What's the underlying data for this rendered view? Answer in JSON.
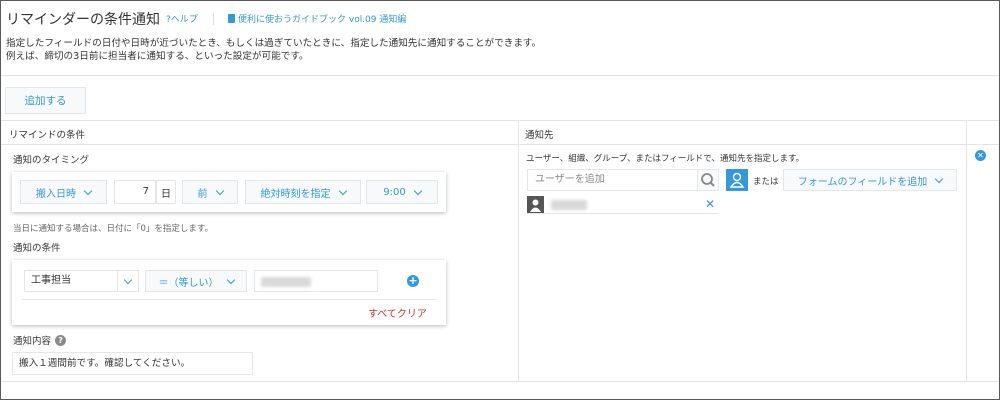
{
  "page": {
    "title": "リマインダーの条件通知",
    "help_label": "?ヘルプ",
    "guide_label": "便利に使おうガイドブック vol.09 通知編",
    "description": [
      "指定したフィールドの日付や日時が近づいたとき、もしくは過ぎていたときに、指定した通知先に通知することができます。",
      "例えば、締切の3日前に担当者に通知する、といった設定が可能です。"
    ],
    "add_button": "追加する"
  },
  "table": {
    "col_condition": "リマインドの条件",
    "col_recipient": "通知先"
  },
  "timing": {
    "label": "通知のタイミング",
    "field": "搬入日時",
    "days_value": "7",
    "days_unit": "日",
    "direction": "前",
    "time_mode": "絶対時刻を指定",
    "time": "9:00",
    "hint": "当日に通知する場合は、日付に「0」を指定します。"
  },
  "condition": {
    "label": "通知の条件",
    "field": "工事担当",
    "operator": "＝（等しい）",
    "clear_all": "すべてクリア"
  },
  "content": {
    "label": "通知内容",
    "value": "搬入１週間前です。確認してください。"
  },
  "recipient": {
    "hint": "ユーザー、組織、グループ、またはフィールドで、通知先を指定します。",
    "user_placeholder": "ユーザーを追加",
    "or_label": "または",
    "form_field_button": "フォームのフィールドを追加"
  },
  "colors": {
    "accent": "#3498db",
    "danger": "#c0392b",
    "border": "#e3e3e3",
    "button_bg": "#f7f9fa"
  },
  "icons": [
    "help-icon",
    "book-icon",
    "search-icon",
    "user-select-icon",
    "user-avatar-icon",
    "remove-icon",
    "add-condition-icon",
    "help-circle-icon",
    "delete-row-icon",
    "chevron-down-icon"
  ]
}
